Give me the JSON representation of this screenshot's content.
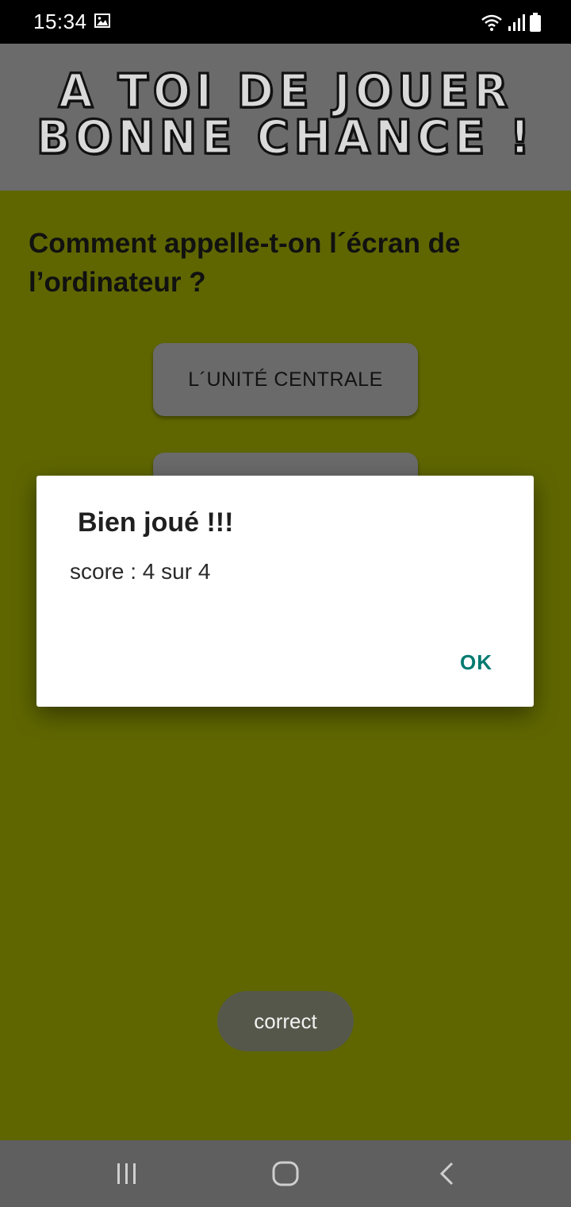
{
  "status_bar": {
    "time": "15:34",
    "icons": [
      "gallery-icon",
      "wifi-icon",
      "signal-icon",
      "battery-icon"
    ]
  },
  "header": {
    "line1": "A TOI DE JOUER",
    "line2": "BONNE CHANCE !"
  },
  "question": {
    "text": "Comment appelle-t-on l´écran de l’ordinateur ?"
  },
  "answers": [
    {
      "label": "L´UNITÉ CENTRALE"
    },
    {
      "label": ""
    }
  ],
  "dialog": {
    "title": "Bien joué !!!",
    "message": "score : 4 sur 4",
    "ok_label": "OK"
  },
  "toast": {
    "text": "correct"
  },
  "navigation": {
    "items": [
      "recent-apps-icon",
      "home-icon",
      "back-icon"
    ]
  },
  "colors": {
    "background": "#5f6600",
    "header": "#6b6b6b",
    "button": "#6a6a6a",
    "accent": "#007a70",
    "navbar": "#5f5f5f"
  }
}
